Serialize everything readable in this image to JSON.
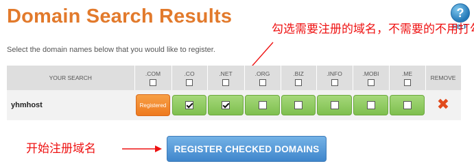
{
  "header": {
    "title": "Domain Search Results",
    "help_label": "HELP",
    "help_glyph": "?"
  },
  "subtitle": "Select the domain names below that you would like to register.",
  "annotations": {
    "top": "勾选需要注册的域名，不需要的不用打勾",
    "bottom": "开始注册域名",
    "color": "#ee1111"
  },
  "table": {
    "search_header": "YOUR SEARCH",
    "remove_header": "REMOVE",
    "tlds": [
      {
        "label": ".COM",
        "checked": false
      },
      {
        "label": ".CO",
        "checked": false
      },
      {
        "label": ".NET",
        "checked": false
      },
      {
        "label": ".ORG",
        "checked": false
      },
      {
        "label": ".BIZ",
        "checked": false
      },
      {
        "label": ".INFO",
        "checked": false
      },
      {
        "label": ".MOBI",
        "checked": false
      },
      {
        "label": ".ME",
        "checked": false
      }
    ],
    "rows": [
      {
        "domain": "yhmhost",
        "registered_label": "Registered",
        "cells": [
          {
            "tld": ".COM",
            "status": "registered"
          },
          {
            "tld": ".CO",
            "status": "available",
            "checked": true
          },
          {
            "tld": ".NET",
            "status": "available",
            "checked": true
          },
          {
            "tld": ".ORG",
            "status": "available",
            "checked": false
          },
          {
            "tld": ".BIZ",
            "status": "available",
            "checked": false
          },
          {
            "tld": ".INFO",
            "status": "available",
            "checked": false
          },
          {
            "tld": ".MOBI",
            "status": "available",
            "checked": false
          },
          {
            "tld": ".ME",
            "status": "available",
            "checked": false
          }
        ],
        "remove_glyph": "✖"
      }
    ]
  },
  "register_button": "REGISTER CHECKED DOMAINS",
  "colors": {
    "title": "#e27a2c",
    "available": "#8cc95e",
    "registered": "#ee7a1f",
    "button": "#4a8fd3",
    "remove": "#e14a1c"
  },
  "icons": [
    "help-icon",
    "remove-icon",
    "arrow-icon"
  ]
}
